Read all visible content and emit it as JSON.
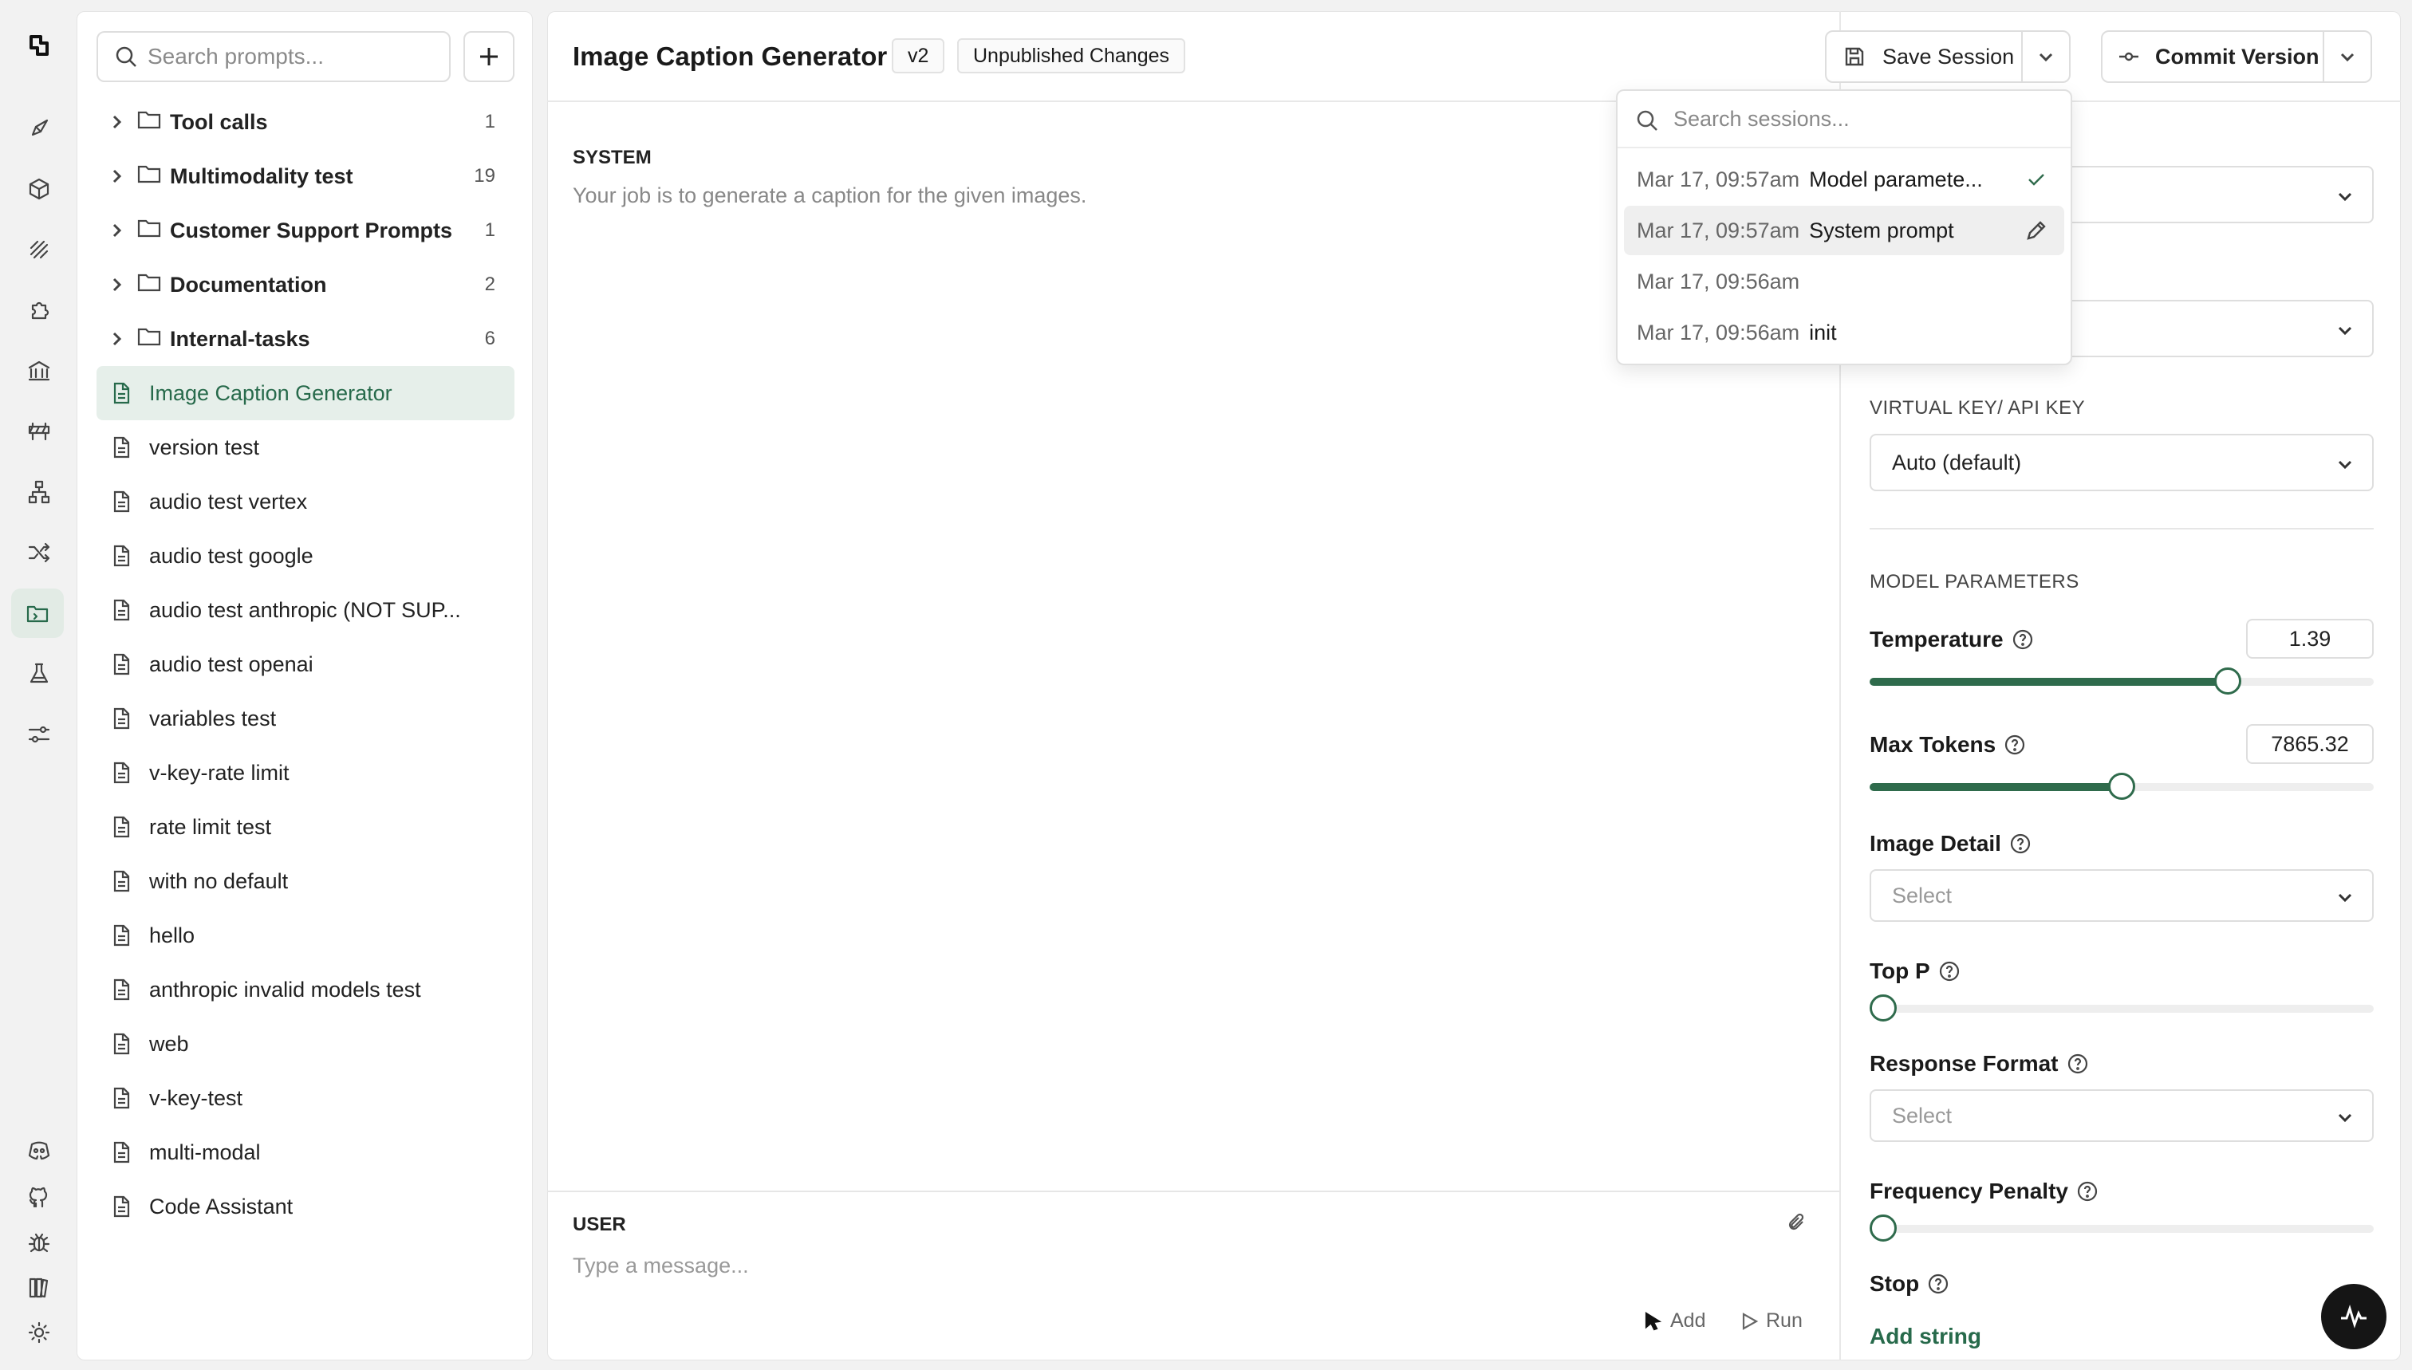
{
  "sidebar": {
    "search_placeholder": "Search prompts...",
    "folders": [
      {
        "name": "Tool calls",
        "count": "1"
      },
      {
        "name": "Multimodality test",
        "count": "19"
      },
      {
        "name": "Customer Support Prompts",
        "count": "1"
      },
      {
        "name": "Documentation",
        "count": "2"
      },
      {
        "name": "Internal-tasks",
        "count": "6"
      }
    ],
    "prompts": [
      "Image Caption Generator",
      "version test",
      "audio test vertex",
      "audio test google",
      "audio test anthropic (NOT SUP...",
      "audio test openai",
      "variables test",
      "v-key-rate limit",
      "rate limit test",
      "with no default",
      "hello",
      "anthropic invalid models test",
      "web",
      "v-key-test",
      "multi-modal",
      "Code Assistant"
    ],
    "selected_prompt": "Image Caption Generator"
  },
  "header": {
    "title": "Image Caption Generator",
    "version": "v2",
    "status": "Unpublished Changes",
    "save_label": "Save Session",
    "commit_label": "Commit Version"
  },
  "editor": {
    "system_label": "SYSTEM",
    "system_text": "Your job is to generate a caption for the given images.",
    "user_label": "USER",
    "user_placeholder": "Type a message...",
    "add_label": "Add",
    "run_label": "Run"
  },
  "sessions": {
    "search_placeholder": "Search sessions...",
    "items": [
      {
        "time": "Mar 17, 09:57am",
        "name": "Model paramete...",
        "state": "current"
      },
      {
        "time": "Mar 17, 09:57am",
        "name": "System prompt",
        "state": "hover"
      },
      {
        "time": "Mar 17, 09:56am",
        "name": "",
        "state": ""
      },
      {
        "time": "Mar 17, 09:56am",
        "name": "init",
        "state": ""
      }
    ]
  },
  "settings": {
    "vkey_label": "VIRTUAL KEY/ API KEY",
    "vkey_value": "Auto (default)",
    "params_label": "MODEL PARAMETERS",
    "temperature": {
      "label": "Temperature",
      "value": "1.39",
      "fraction": 0.71
    },
    "max_tokens": {
      "label": "Max Tokens",
      "value": "7865.32",
      "fraction": 0.5
    },
    "image_detail": {
      "label": "Image Detail",
      "value": "Select"
    },
    "top_p": {
      "label": "Top P",
      "fraction": 0
    },
    "response_format": {
      "label": "Response Format",
      "value": "Select"
    },
    "frequency_penalty": {
      "label": "Frequency Penalty",
      "fraction": 0
    },
    "stop": {
      "label": "Stop",
      "add_label": "Add string"
    }
  },
  "colors": {
    "accent": "#2f6b4c",
    "selected_bg": "#e6efea"
  }
}
